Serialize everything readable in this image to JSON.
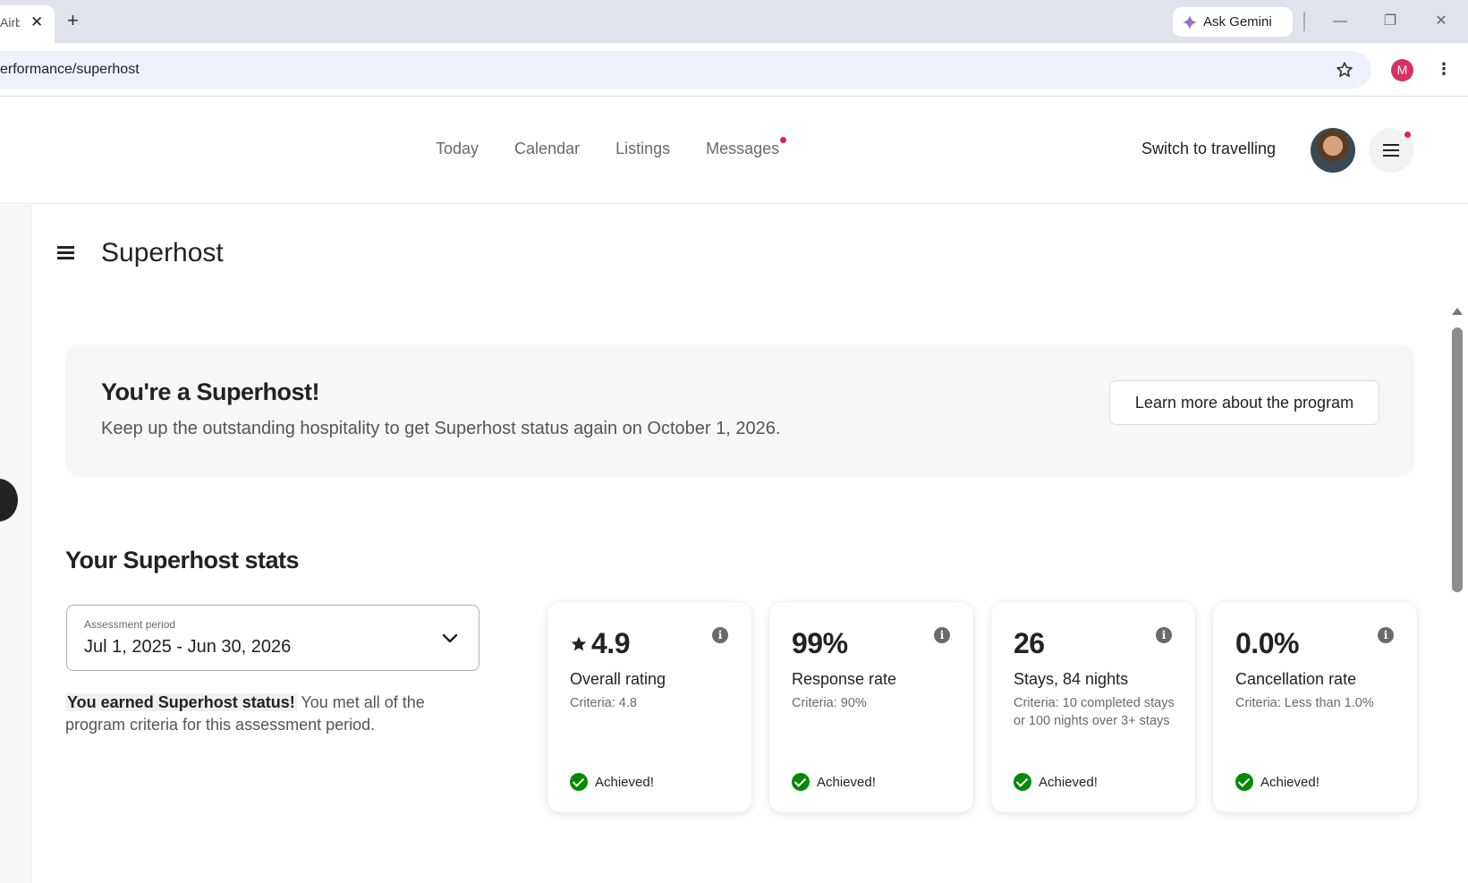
{
  "browser": {
    "tab_title": "Airb",
    "tab_close": "✕",
    "new_tab": "+",
    "ask_gemini": "Ask Gemini",
    "url": "erformance/superhost",
    "profile_initial": "M",
    "menu_glyph": "⋮",
    "window_minimize": "—",
    "window_restore": "❐",
    "window_close": "✕"
  },
  "nav": {
    "items": [
      "Today",
      "Calendar",
      "Listings",
      "Messages"
    ],
    "switch_label": "Switch to travelling"
  },
  "page": {
    "title": "Superhost"
  },
  "banner": {
    "title": "You're a Superhost!",
    "text": "Keep up the outstanding hospitality to get Superhost status again on October 1, 2026.",
    "button": "Learn more about the program"
  },
  "stats": {
    "heading": "Your Superhost stats",
    "period_label": "Assessment period",
    "period_value": "Jul 1, 2025 - Jun 30, 2026",
    "status_strong": "You earned Superhost status!",
    "status_rest": " You met all of the program criteria for this assessment period.",
    "cards": [
      {
        "value": "4.9",
        "name": "Overall rating",
        "criteria": "Criteria: 4.8",
        "achieved": "Achieved!"
      },
      {
        "value": "99%",
        "name": "Response rate",
        "criteria": "Criteria: 90%",
        "achieved": "Achieved!"
      },
      {
        "value": "26",
        "name": "Stays, 84 nights",
        "criteria": "Criteria: 10 completed stays or 100 nights over 3+ stays",
        "achieved": "Achieved!"
      },
      {
        "value": "0.0%",
        "name": "Cancellation rate",
        "criteria": "Criteria: Less than 1.0%",
        "achieved": "Achieved!"
      }
    ]
  },
  "icons": {
    "info": "i",
    "brand_color": "#e31c5f",
    "success_color": "#008a05"
  }
}
